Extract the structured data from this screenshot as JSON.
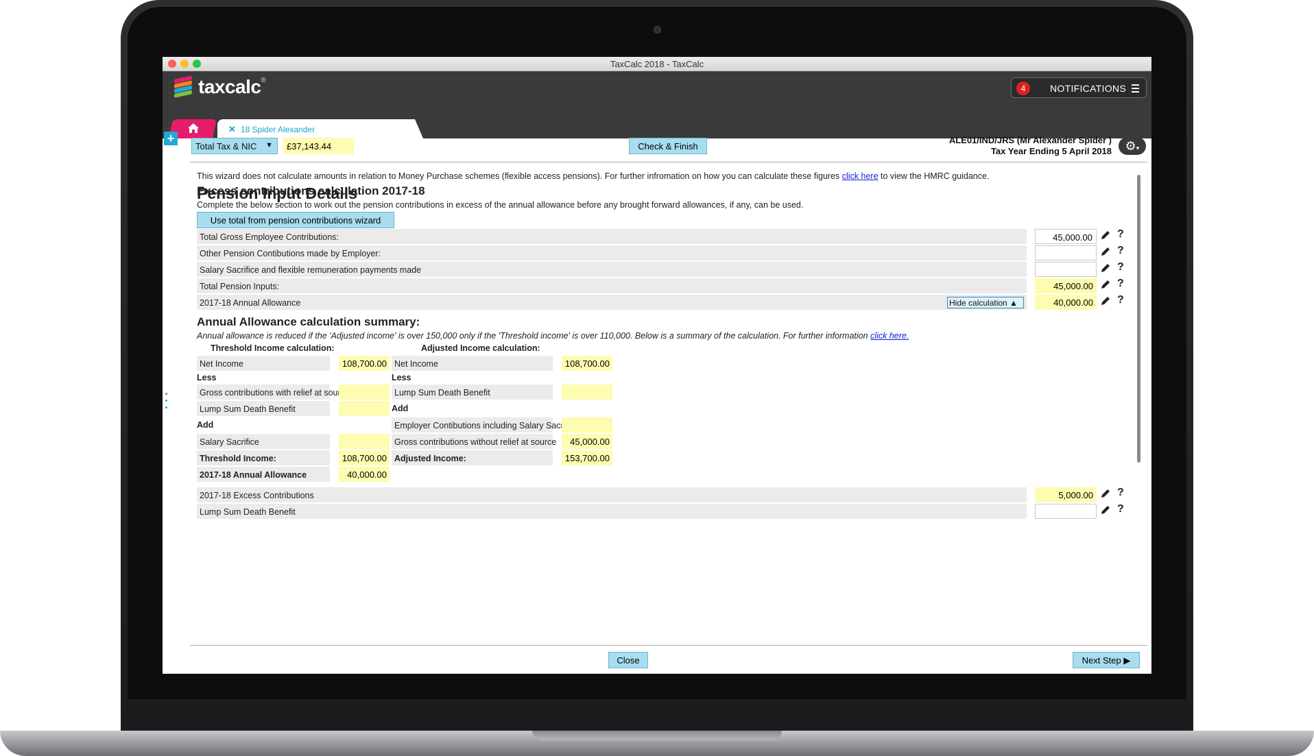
{
  "window": {
    "title": "TaxCalc 2018  - TaxCalc"
  },
  "app": {
    "logo_text": "taxcalc",
    "logo_reg": "®",
    "notifications": {
      "count": "4",
      "label": "NOTIFICATIONS"
    },
    "tab": {
      "close": "✕",
      "name": "18 Spider Alexander"
    }
  },
  "toolbar": {
    "select_value": "Total Tax & NIC",
    "total_amount": "£37,143.44",
    "check_finish": "Check & Finish",
    "client_line1": "ALE01/IND/JRS (Mr Alexander Spider )",
    "client_line2": "Tax Year Ending 5 April 2018"
  },
  "content": {
    "title": "Pension Input Details",
    "intro_pre": "This wizard does not calculate amounts in relation to Money Purchase schemes (flexible access pensions). For further infromation on how you can calculate these figures ",
    "intro_link": "click here",
    "intro_post": " to view the HMRC guidance.",
    "excess_heading": "Excess contributions calculation 2017-18",
    "excess_desc": "Complete the below section to work out the pension contributions in excess of the annual allowance before any brought forward allowances, if any, can be used.",
    "wizard_button": "Use total from pension contributions wizard",
    "rows": [
      {
        "label": "Total Gross Employee Contributions:",
        "value": "45,000.00"
      },
      {
        "label": "Other Pension Contibutions made by Employer:",
        "value": ""
      },
      {
        "label": "Salary Sacrifice and flexible remuneration payments made",
        "value": ""
      },
      {
        "label": "Total Pension Inputs:",
        "value": "45,000.00"
      },
      {
        "label": "2017-18 Annual Allowance",
        "value": "40,000.00"
      }
    ],
    "hide_calc": "Hide calculation ▲",
    "summary_heading": "Annual Allowance calculation summary:",
    "summary_note_pre": "Annual allowance is reduced if the 'Adjusted income' is over 150,000 only if the 'Threshold income' is over 110,000. Below is a summary of the calculation. For further information ",
    "summary_note_link": "click here.",
    "threshold": {
      "heading": "Threshold Income calculation:",
      "net_income_label": "Net Income",
      "net_income": "108,700.00",
      "less": "Less",
      "gross_relief_label": "Gross contributions with relief at source",
      "gross_relief": "",
      "lump_label": "Lump Sum Death Benefit",
      "lump": "",
      "add": "Add",
      "sal_sac_label": "Salary Sacrifice",
      "sal_sac": "",
      "threshold_label": "Threshold Income:",
      "threshold": "108,700.00",
      "allowance_label": "2017-18 Annual Allowance",
      "allowance": "40,000.00"
    },
    "adjusted": {
      "heading": "Adjusted Income calculation:",
      "net_income_label": "Net Income",
      "net_income": "108,700.00",
      "less": "Less",
      "lump_label": "Lump Sum Death Benefit",
      "lump": "",
      "add": "Add",
      "employer_label": "Employer Contibutions including Salary Sacrifice",
      "employer": "",
      "gross_norelief_label": "Gross contributions without relief at source",
      "gross_norelief": "45,000.00",
      "adjusted_label": "Adjusted Income:",
      "adjusted": "153,700.00"
    },
    "bottom_rows": [
      {
        "label": "2017-18 Excess Contributions",
        "value": "5,000.00"
      },
      {
        "label": "Lump Sum Death Benefit",
        "value": ""
      }
    ],
    "question": "?"
  },
  "footer": {
    "close": "Close",
    "next": "Next Step ▶"
  },
  "colors": {
    "accent": "#a8dcef",
    "highlight": "#fdfcb0",
    "brand_pink": "#e61c6a",
    "tab_text": "#1aa3c9"
  }
}
